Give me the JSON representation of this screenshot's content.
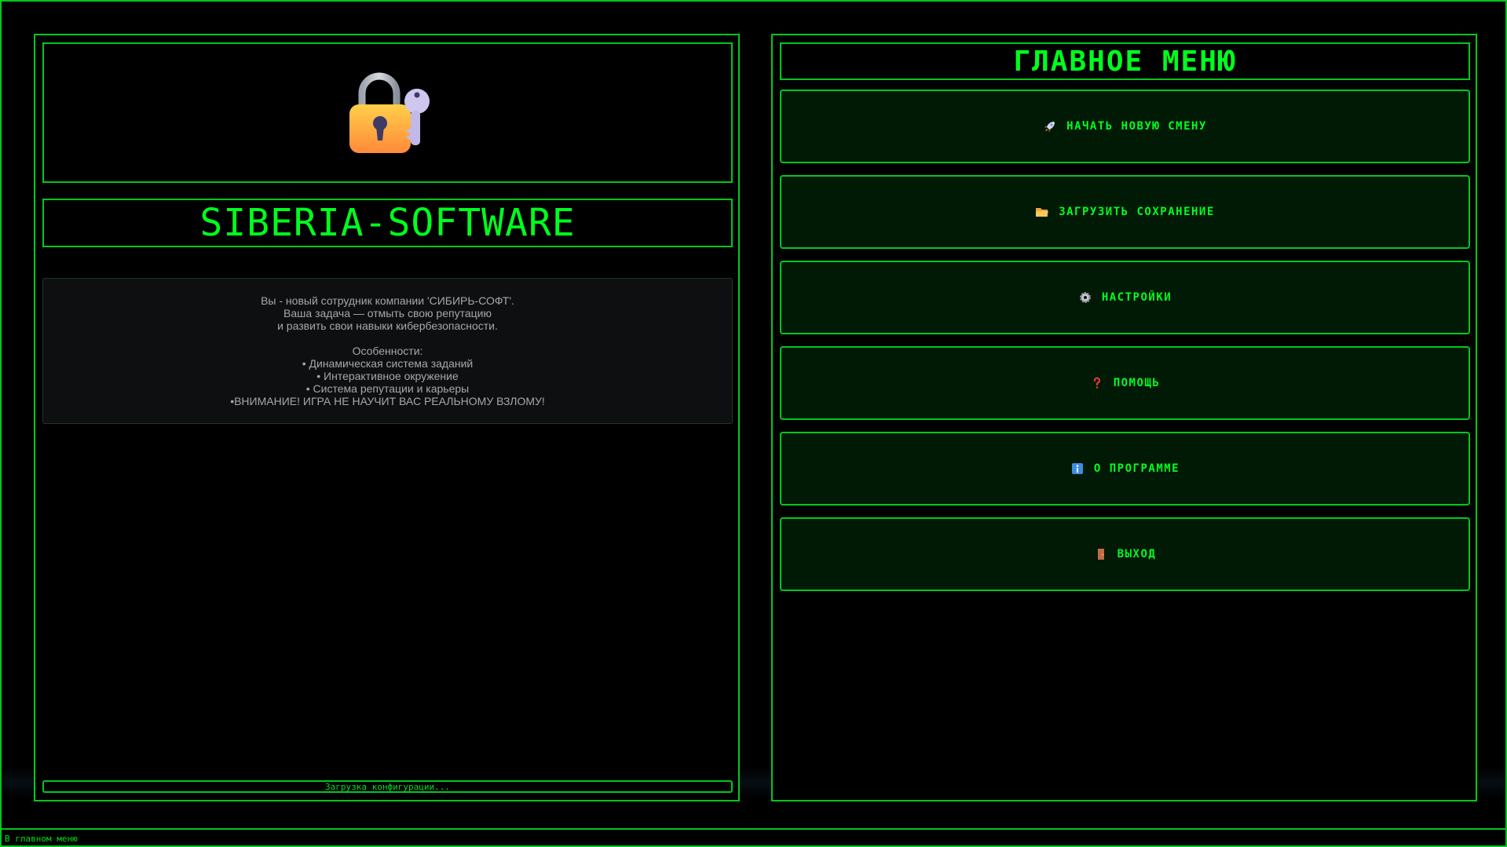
{
  "app": {
    "title": "SIBERIA-SOFTWARE"
  },
  "description": {
    "lines": [
      "Вы - новый сотрудник компании 'СИБИРЬ-СОФТ'.",
      "Ваша задача — отмыть свою репутацию",
      "и развить свои навыки кибербезопасности.",
      "",
      "Особенности:",
      "• Динамическая система заданий",
      "• Интерактивное окружение",
      "• Система репутации и карьеры",
      "•ВНИМАНИЕ! ИГРА НЕ НАУЧИТ ВАС РЕАЛЬНОМУ ВЗЛОМУ!"
    ]
  },
  "loading": {
    "text": "Загрузка конфигурации..."
  },
  "menu": {
    "title": "ГЛАВНОЕ МЕНЮ",
    "items": [
      {
        "label": "НАЧАТЬ НОВУЮ СМЕНУ",
        "icon": "rocket-icon"
      },
      {
        "label": "ЗАГРУЗИТЬ СОХРАНЕНИЕ",
        "icon": "folder-icon"
      },
      {
        "label": "НАСТРОЙКИ",
        "icon": "gear-icon"
      },
      {
        "label": "ПОМОЩЬ",
        "icon": "question-icon"
      },
      {
        "label": "О ПРОГРАММЕ",
        "icon": "info-icon"
      },
      {
        "label": "ВЫХОД",
        "icon": "door-icon"
      }
    ]
  },
  "status_bar": {
    "text": "В главном меню"
  },
  "colors": {
    "accent": "#00ff1e",
    "border": "#00c81e",
    "button_bg": "#001a05",
    "background": "#000000",
    "desc_text": "#a8a8a8"
  }
}
